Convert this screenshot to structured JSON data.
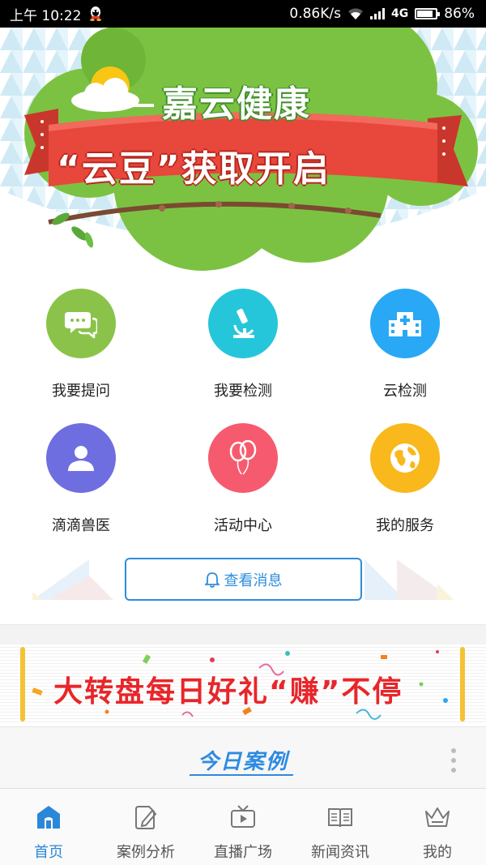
{
  "status_bar": {
    "time": "上午 10:22",
    "network_speed": "0.86K/s",
    "network_type": "4G",
    "battery": "86%",
    "battery_level": 0.86
  },
  "banner": {
    "title": "嘉云健康",
    "ribbon_text": "“云豆”获取开启",
    "colors": {
      "tree": "#7cc242",
      "ribbon": "#e8473b",
      "sky": "#d8eef6"
    }
  },
  "grid": {
    "items": [
      {
        "label": "我要提问",
        "icon": "chat-bubbles-icon",
        "color": "#8bc34a"
      },
      {
        "label": "我要检测",
        "icon": "microscope-icon",
        "color": "#26c6da"
      },
      {
        "label": "云检测",
        "icon": "hospital-icon",
        "color": "#29a8f5"
      },
      {
        "label": "滴滴兽医",
        "icon": "user-icon",
        "color": "#6f6ee0"
      },
      {
        "label": "活动中心",
        "icon": "balloons-icon",
        "color": "#f65a6e"
      },
      {
        "label": "我的服务",
        "icon": "globe-icon",
        "color": "#f9b81b"
      }
    ]
  },
  "message_button": {
    "label": "查看消息",
    "icon": "bell-icon"
  },
  "lottery_banner": {
    "text": "大转盘每日好礼“赚”不停"
  },
  "today_section": {
    "title": "今日案例",
    "more_icon": "more-vertical-icon"
  },
  "bottom_nav": {
    "items": [
      {
        "label": "首页",
        "icon": "home-icon",
        "active": true
      },
      {
        "label": "案例分析",
        "icon": "edit-doc-icon",
        "active": false
      },
      {
        "label": "直播广场",
        "icon": "tv-icon",
        "active": false
      },
      {
        "label": "新闻资讯",
        "icon": "book-icon",
        "active": false
      },
      {
        "label": "我的",
        "icon": "crown-icon",
        "active": false
      }
    ],
    "active_color": "#2b87d8",
    "inactive_color": "#555555"
  }
}
